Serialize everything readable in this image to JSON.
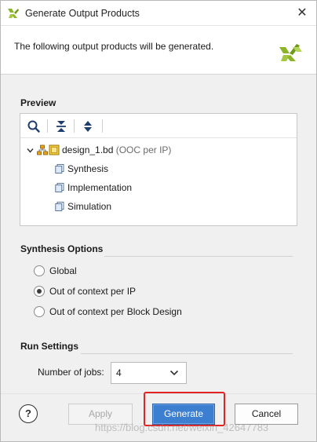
{
  "window": {
    "title": "Generate Output Products",
    "close_glyph": "✕"
  },
  "header": {
    "description": "The following output products will be generated."
  },
  "preview": {
    "label": "Preview",
    "toolbar_icons": [
      "search-icon",
      "collapse-all-icon",
      "expand-all-icon"
    ],
    "tree": {
      "root_name": "design_1.bd",
      "root_suffix": " (OOC per IP)",
      "children": [
        "Synthesis",
        "Implementation",
        "Simulation"
      ]
    }
  },
  "synthesis_options": {
    "label": "Synthesis Options",
    "options": [
      {
        "label": "Global",
        "selected": false
      },
      {
        "label": "Out of context per IP",
        "selected": true
      },
      {
        "label": "Out of context per Block Design",
        "selected": false
      }
    ]
  },
  "run_settings": {
    "label": "Run Settings",
    "jobs_label": "Number of jobs:",
    "jobs_value": "4"
  },
  "footer": {
    "help_label": "?",
    "apply_label": "Apply",
    "generate_label": "Generate",
    "cancel_label": "Cancel",
    "apply_enabled": false
  },
  "watermark": "https://blog.csdn.net/weixin_42647783",
  "colors": {
    "accent": "#3c7fd1",
    "highlight": "#e02424",
    "logo": "#8cb429"
  }
}
